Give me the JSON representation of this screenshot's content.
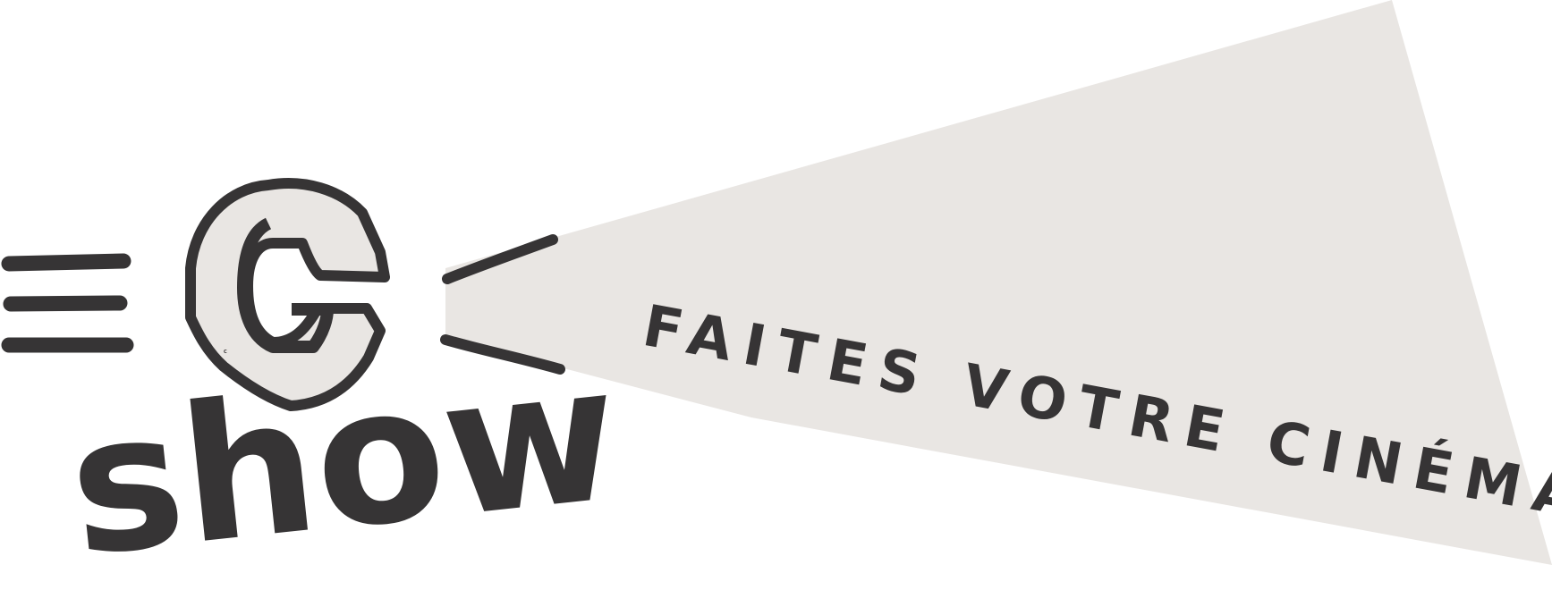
{
  "logo": {
    "letter": "C",
    "word": "show",
    "tagline": "FAITES VOTRE CINÉMA"
  },
  "colors": {
    "ink": "#363435",
    "beam": "#e9e6e3",
    "background": "#ffffff"
  }
}
